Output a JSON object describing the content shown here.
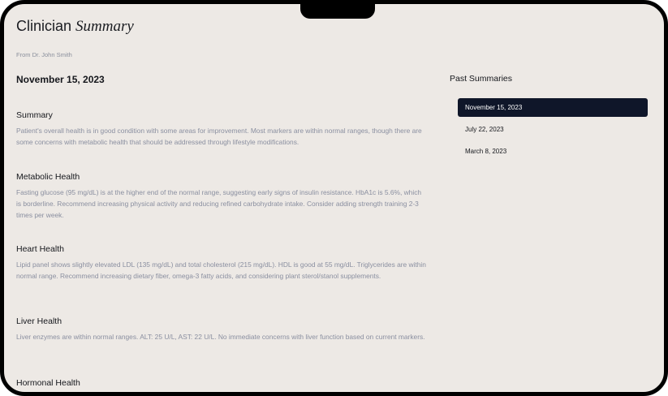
{
  "header": {
    "title_plain": "Clinician",
    "title_italic": "Summary",
    "from": "From Dr. John Smith"
  },
  "report": {
    "date": "November 15, 2023",
    "sections": [
      {
        "title": "Summary",
        "body": "Patient's overall health is in good condition with some areas for improvement. Most markers are within normal ranges, though there are some concerns with metabolic health that should be addressed through lifestyle modifications."
      },
      {
        "title": "Metabolic Health",
        "body": "Fasting glucose (95 mg/dL) is at the higher end of the normal range, suggesting early signs of insulin resistance. HbA1c is 5.6%, which is borderline. Recommend increasing physical activity and reducing refined carbohydrate intake. Consider adding strength training 2-3 times per week."
      },
      {
        "title": "Heart Health",
        "body": "Lipid panel shows slightly elevated LDL (135 mg/dL) and total cholesterol (215 mg/dL). HDL is good at 55 mg/dL. Triglycerides are within normal range. Recommend increasing dietary fiber, omega-3 fatty acids, and considering plant sterol/stanol supplements."
      },
      {
        "title": "Liver Health",
        "body": "Liver enzymes are within normal ranges. ALT: 25 U/L, AST: 22 U/L. No immediate concerns with liver function based on current markers."
      },
      {
        "title": "Hormonal Health",
        "body": ""
      }
    ]
  },
  "past_summaries": {
    "heading": "Past Summaries",
    "items": [
      {
        "label": "November 15, 2023",
        "selected": true
      },
      {
        "label": "July 22, 2023",
        "selected": false
      },
      {
        "label": "March 8, 2023",
        "selected": false
      }
    ]
  },
  "colors": {
    "background": "#ede9e5",
    "selected_item_bg": "#0f1629",
    "body_text": "#8a8fa0"
  }
}
